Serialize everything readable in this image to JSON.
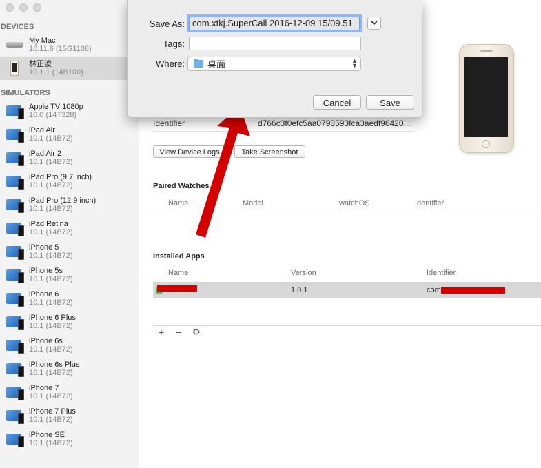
{
  "sidebar": {
    "devices_header": "DEVICES",
    "simulators_header": "SIMULATORS",
    "devices": [
      {
        "name": "My Mac",
        "version": "10.11.6 (15G1108)",
        "icon": "mac-icon"
      },
      {
        "name": "林正波",
        "version": "10.1.1 (14B100)",
        "icon": "iphone-icon",
        "selected": true
      }
    ],
    "simulators": [
      {
        "name": "Apple TV 1080p",
        "version": "10.0 (14T328)"
      },
      {
        "name": "iPad Air",
        "version": "10.1 (14B72)"
      },
      {
        "name": "iPad Air 2",
        "version": "10.1 (14B72)"
      },
      {
        "name": "iPad Pro (9.7 inch)",
        "version": "10.1 (14B72)"
      },
      {
        "name": "iPad Pro (12.9 inch)",
        "version": "10.1 (14B72)"
      },
      {
        "name": "iPad Retina",
        "version": "10.1 (14B72)"
      },
      {
        "name": "iPhone 5",
        "version": "10.1 (14B72)"
      },
      {
        "name": "iPhone 5s",
        "version": "10.1 (14B72)"
      },
      {
        "name": "iPhone 6",
        "version": "10.1 (14B72)"
      },
      {
        "name": "iPhone 6 Plus",
        "version": "10.1 (14B72)"
      },
      {
        "name": "iPhone 6s",
        "version": "10.1 (14B72)"
      },
      {
        "name": "iPhone 6s Plus",
        "version": "10.1 (14B72)"
      },
      {
        "name": "iPhone 7",
        "version": "10.1 (14B72)"
      },
      {
        "name": "iPhone 7 Plus",
        "version": "10.1 (14B72)"
      },
      {
        "name": "iPhone SE",
        "version": "10.1 (14B72)"
      }
    ]
  },
  "device_detail": {
    "identifier_label": "Identifier",
    "identifier_value": "d766c3f0efc5aa0793593fca3aedf96420...",
    "view_logs_label": "View Device Logs",
    "screenshot_label": "Take Screenshot"
  },
  "paired_watches": {
    "title": "Paired Watches",
    "columns": [
      "Name",
      "Model",
      "watchOS",
      "Identifier"
    ]
  },
  "installed_apps": {
    "title": "Installed Apps",
    "columns": [
      "Name",
      "Version",
      "Identifier"
    ],
    "rows": [
      {
        "name": "",
        "version": "1.0.1",
        "identifier": "com"
      }
    ],
    "toolbar": {
      "add": "+",
      "remove": "−",
      "gear": "⚙"
    }
  },
  "save_dialog": {
    "save_as_label": "Save As:",
    "save_as_value": "com.xtkj.SuperCall 2016-12-09 15/09.51",
    "tags_label": "Tags:",
    "tags_value": "",
    "where_label": "Where:",
    "where_value": "桌面",
    "cancel_label": "Cancel",
    "save_label": "Save"
  },
  "colors": {
    "annotation_arrow": "#d40000",
    "redaction": "#d40000",
    "selection": "#d8d8d8",
    "focus_ring": "#8fb6ee"
  }
}
